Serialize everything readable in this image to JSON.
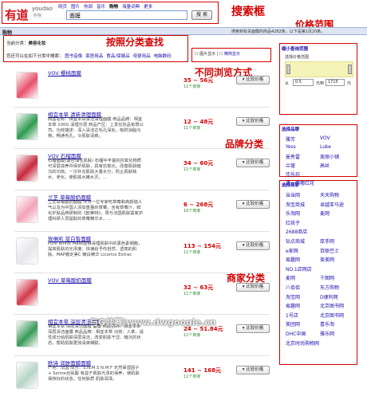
{
  "header": {
    "logo": "有道",
    "logo_en": "youdao",
    "logo_tag": "购物",
    "nav": [
      "网页",
      "图片",
      "热闻",
      "音乐",
      "购物",
      "海量词典",
      "更多"
    ],
    "search_value": "面膜",
    "search_button": "搜 索"
  },
  "annotations": {
    "search": "搜索框",
    "price": "价格范围",
    "category": "按照分类查找",
    "view": "不同浏览方式",
    "brand": "品牌分类",
    "shop": "商家分类"
  },
  "category_bar": {
    "title": "购物",
    "count": "搜索到有关面膜的商品4282条，以下是第1页20条。"
  },
  "filter": {
    "current_label": "当前分类：",
    "current_value": "美容化妆",
    "hint": "您还可以在如下分类中搜索：",
    "links": [
      "图书音像",
      "家居用品",
      "食品/保健品",
      "母婴用品",
      "电脑数码"
    ],
    "view_text": "图片显示",
    "view_link": "精简显示"
  },
  "price_panel": {
    "title": "缩小查询范围",
    "subtitle": "选择价格范围",
    "from_label": "从",
    "from_value": "0.5",
    "to_label": "元到",
    "to_value": "1715",
    "unit": "元"
  },
  "brands": {
    "title": "选择品牌",
    "items": [
      "雅芳",
      "VOV",
      "Yess",
      "Luke",
      "曼秀雷",
      "美丽小铺",
      "兰蔻",
      "高丝",
      "佳乐坊",
      "",
      "清一西嘟红花",
      ""
    ]
  },
  "shops": {
    "title": "选择商家",
    "items": [
      "当当网",
      "天天购物",
      "淘宝商城",
      "卓越亚马逊",
      "乐淘网",
      "麦网",
      "红孩子",
      "",
      "2688商店",
      "",
      "钻点商城",
      "厚手网",
      "e家网",
      "百联巴士",
      "易趣网",
      "美美网",
      "NO.1店网店",
      "",
      "麦网",
      "千图网",
      "八佰佰",
      "东方购物",
      "淘宝网",
      "D便利网",
      "易趣网",
      "北京图书网",
      "1号店",
      "北京图书网",
      "美团网",
      "喜乐淘",
      "DHC中国",
      "雅乐网",
      "北京时尚购物网",
      ""
    ]
  },
  "products": [
    {
      "title": "VOV 樱桃面膜",
      "desc": "",
      "price": "35 ~ 56元",
      "shops": "11个商家",
      "compare": "比较价格",
      "color": "#e8506a"
    },
    {
      "title": "相宜本草 清新清理面膜",
      "desc": "商品名称：相宜本草清洁清理面膜 商品品牌：相宜本草 100G 清理分层 商品产区：上发化妆品有限公司。功效描述：深入清洁达毛孔深处，吸附油脂污物，畅通毛孔，令肌肤清爽。",
      "price": "12 ~ 48元",
      "shops": "11个商家",
      "compare": "比较价格",
      "color": "#2e9a4e"
    },
    {
      "title": "VOV 石榴面膜",
      "desc": "石榴面膜(适合油性肌肤) 石榴中丰富的抗氧化物质可深层滋养并保护肌肤，具有抗氧化，改善肌肤暗沉的功效。一次补充肌肤大量水分，防止肌肤缺水、老化，使肌肤水嫩水灵，...",
      "price": "34 ~ 60元",
      "shops": "11个商家",
      "compare": "比较价格",
      "color": "#c8283c"
    },
    {
      "title": "兰芝 草莓酸奶面膜",
      "desc": "兰芝草莓酸奶面膜 作为一位专家吃草莓和高颜值人气以及为中国人添加重量的草莓，含有草莓汁，鲜化护肤品牌研制的《欧莱特》，再与法国肌肤需氧护理科研人员提取的草莓精华水，...",
      "price": "6 ~ 268元",
      "shops": "16个商家",
      "compare": "比较价格",
      "color": "#f2a3b8"
    },
    {
      "title": "玫琳凯 蓝白皙面膜",
      "desc": "Pure White Mask能够清理肌肤中的黑色素细胞，提高肌肤的光泽度，快速给予你自然、透亮的肌肤。MAP稳定美C 嫩白精华 Licorice Extrac",
      "price": "113 ~ 154元",
      "shops": "11个商家",
      "compare": "比较价格",
      "color": "#e7e7ec"
    },
    {
      "title": "VOV 草莓酸奶面膜",
      "desc": "",
      "price": "32 ~ 63元",
      "shops": "11个商家",
      "compare": "比较价格",
      "color": "#d43a4a"
    },
    {
      "title": "相宜本草 深层清洁面膜",
      "desc": "相宜本草 深层清洁面膜 面膜 商品名称：相宜本草 深层清洁面膜 商品品牌：相宜本草 功效：入季，适性成分给肌肤深层清洁，改变肌肤干涩、暗沉的状态，帮助肌肤更加清爽细腻。",
      "price": "24 ~ 51.84元",
      "shops": "11个商家",
      "compare": "比较价格",
      "color": "#3a9a5a"
    },
    {
      "title": "欧诗 润肤面膜面膜",
      "desc": "产地：法国 成分：S.N.M.S N.M.F 天然保湿因子 + Serine丝氨酸 有益于肌肤光泽的保养，使肌肤保持好的状态。任何肤质 肌肤润泽。",
      "price": "141 ~ 168元",
      "shops": "11个商家",
      "compare": "比较价格",
      "color": "#b8d4c8"
    }
  ],
  "watermark": "与G共舞|www.dwgoogle.cn"
}
